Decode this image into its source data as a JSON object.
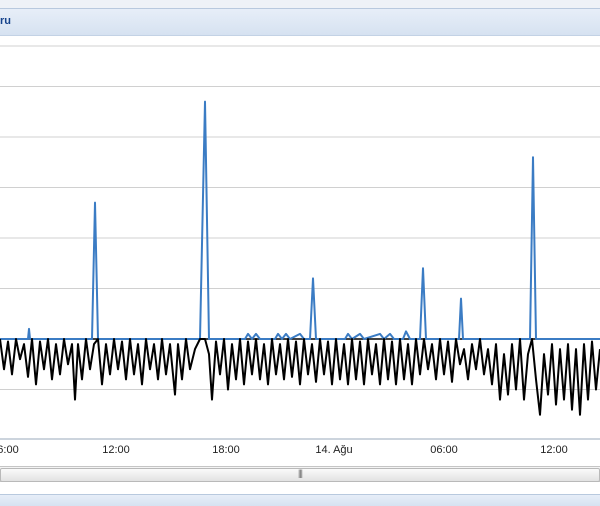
{
  "window": {
    "title_fragment": "ru"
  },
  "chart_data": {
    "type": "line",
    "x_tick_labels": [
      "6:00",
      "12:00",
      "18:00",
      "14. Ağu",
      "06:00",
      "12:00"
    ],
    "ylim": [
      -2,
      6
    ],
    "threshold_value": 0,
    "grid": true,
    "series": [
      {
        "color": "#3b7cc4",
        "points": [
          [
            0,
            0
          ],
          [
            28,
            0
          ],
          [
            29,
            0.2
          ],
          [
            30,
            0
          ],
          [
            92,
            0
          ],
          [
            95,
            2.7
          ],
          [
            98,
            0
          ],
          [
            200,
            0
          ],
          [
            205,
            4.7
          ],
          [
            209,
            0
          ],
          [
            245,
            0
          ],
          [
            248,
            0.1
          ],
          [
            252,
            0
          ],
          [
            256,
            0.1
          ],
          [
            260,
            0
          ],
          [
            275,
            0
          ],
          [
            278,
            0.1
          ],
          [
            282,
            0
          ],
          [
            286,
            0.1
          ],
          [
            290,
            0
          ],
          [
            300,
            0.1
          ],
          [
            304,
            0
          ],
          [
            310,
            0
          ],
          [
            313,
            1.2
          ],
          [
            316,
            0
          ],
          [
            345,
            0
          ],
          [
            348,
            0.1
          ],
          [
            352,
            0
          ],
          [
            360,
            0.1
          ],
          [
            364,
            0
          ],
          [
            380,
            0.1
          ],
          [
            384,
            0
          ],
          [
            390,
            0.1
          ],
          [
            394,
            0
          ],
          [
            403,
            0
          ],
          [
            406,
            0.15
          ],
          [
            410,
            0
          ],
          [
            420,
            0
          ],
          [
            423,
            1.4
          ],
          [
            426,
            0
          ],
          [
            459,
            0
          ],
          [
            461,
            0.8
          ],
          [
            463,
            0
          ],
          [
            530,
            0
          ],
          [
            533,
            3.6
          ],
          [
            536,
            0
          ],
          [
            600,
            0
          ]
        ]
      },
      {
        "color": "#000000",
        "points": [
          [
            0,
            0
          ],
          [
            4,
            -0.6
          ],
          [
            8,
            -0.05
          ],
          [
            12,
            -0.7
          ],
          [
            16,
            0
          ],
          [
            20,
            -0.4
          ],
          [
            24,
            -0.1
          ],
          [
            28,
            -0.75
          ],
          [
            32,
            0
          ],
          [
            36,
            -0.9
          ],
          [
            40,
            -0.05
          ],
          [
            44,
            -0.6
          ],
          [
            48,
            0
          ],
          [
            52,
            -0.8
          ],
          [
            56,
            -0.1
          ],
          [
            60,
            -0.7
          ],
          [
            64,
            0
          ],
          [
            68,
            -0.5
          ],
          [
            72,
            -0.1
          ],
          [
            75,
            -1.2
          ],
          [
            78,
            -0.1
          ],
          [
            82,
            -0.8
          ],
          [
            86,
            0
          ],
          [
            90,
            -0.6
          ],
          [
            94,
            -0.1
          ],
          [
            98,
            0
          ],
          [
            102,
            -0.9
          ],
          [
            106,
            -0.1
          ],
          [
            110,
            -0.7
          ],
          [
            114,
            0
          ],
          [
            118,
            -0.6
          ],
          [
            122,
            -0.05
          ],
          [
            126,
            -0.8
          ],
          [
            130,
            0
          ],
          [
            134,
            -0.7
          ],
          [
            138,
            -0.1
          ],
          [
            142,
            -0.9
          ],
          [
            146,
            0
          ],
          [
            150,
            -0.6
          ],
          [
            154,
            -0.1
          ],
          [
            158,
            -0.8
          ],
          [
            162,
            0
          ],
          [
            166,
            -0.7
          ],
          [
            170,
            -0.1
          ],
          [
            175,
            -1.1
          ],
          [
            178,
            -0.1
          ],
          [
            182,
            -0.8
          ],
          [
            186,
            0
          ],
          [
            190,
            -0.6
          ],
          [
            195,
            -0.2
          ],
          [
            200,
            0
          ],
          [
            205,
            0
          ],
          [
            209,
            -0.3
          ],
          [
            212,
            -1.2
          ],
          [
            216,
            -0.05
          ],
          [
            220,
            -0.7
          ],
          [
            224,
            0
          ],
          [
            228,
            -1.0
          ],
          [
            232,
            -0.1
          ],
          [
            236,
            -0.8
          ],
          [
            240,
            0
          ],
          [
            244,
            -0.9
          ],
          [
            248,
            -0.05
          ],
          [
            252,
            -0.7
          ],
          [
            256,
            0
          ],
          [
            260,
            -0.8
          ],
          [
            264,
            -0.1
          ],
          [
            268,
            -0.9
          ],
          [
            272,
            0
          ],
          [
            276,
            -0.7
          ],
          [
            280,
            -0.1
          ],
          [
            284,
            -0.8
          ],
          [
            288,
            0
          ],
          [
            292,
            -0.75
          ],
          [
            296,
            -0.05
          ],
          [
            300,
            -0.9
          ],
          [
            304,
            0
          ],
          [
            308,
            -0.7
          ],
          [
            312,
            -0.1
          ],
          [
            316,
            -0.85
          ],
          [
            320,
            0
          ],
          [
            324,
            -0.7
          ],
          [
            328,
            -0.05
          ],
          [
            332,
            -0.9
          ],
          [
            336,
            0
          ],
          [
            340,
            -0.8
          ],
          [
            344,
            -0.1
          ],
          [
            348,
            -0.9
          ],
          [
            352,
            0
          ],
          [
            356,
            -0.8
          ],
          [
            360,
            -0.05
          ],
          [
            364,
            -0.9
          ],
          [
            368,
            0
          ],
          [
            372,
            -0.7
          ],
          [
            376,
            -0.1
          ],
          [
            380,
            -0.9
          ],
          [
            384,
            0
          ],
          [
            388,
            -0.8
          ],
          [
            392,
            -0.05
          ],
          [
            396,
            -0.9
          ],
          [
            400,
            0
          ],
          [
            404,
            -0.8
          ],
          [
            408,
            -0.1
          ],
          [
            412,
            -0.9
          ],
          [
            416,
            0
          ],
          [
            420,
            -0.7
          ],
          [
            424,
            0
          ],
          [
            428,
            -0.6
          ],
          [
            432,
            -0.1
          ],
          [
            436,
            -0.8
          ],
          [
            440,
            0
          ],
          [
            444,
            -0.7
          ],
          [
            448,
            -0.05
          ],
          [
            452,
            -0.85
          ],
          [
            456,
            0
          ],
          [
            460,
            -0.5
          ],
          [
            464,
            -0.2
          ],
          [
            468,
            -0.8
          ],
          [
            472,
            -0.1
          ],
          [
            476,
            -0.6
          ],
          [
            480,
            0
          ],
          [
            484,
            -0.7
          ],
          [
            488,
            -0.2
          ],
          [
            492,
            -0.9
          ],
          [
            496,
            -0.1
          ],
          [
            500,
            -1.2
          ],
          [
            504,
            -0.3
          ],
          [
            508,
            -1.1
          ],
          [
            512,
            -0.1
          ],
          [
            516,
            -1.0
          ],
          [
            520,
            0
          ],
          [
            524,
            -1.2
          ],
          [
            528,
            -0.3
          ],
          [
            532,
            0
          ],
          [
            536,
            -0.8
          ],
          [
            540,
            -1.5
          ],
          [
            544,
            -0.3
          ],
          [
            548,
            -1.1
          ],
          [
            552,
            -0.1
          ],
          [
            556,
            -1.3
          ],
          [
            560,
            -0.2
          ],
          [
            564,
            -1.2
          ],
          [
            568,
            -0.1
          ],
          [
            572,
            -1.4
          ],
          [
            576,
            -0.2
          ],
          [
            580,
            -1.5
          ],
          [
            584,
            -0.1
          ],
          [
            588,
            -1.2
          ],
          [
            592,
            -0.05
          ],
          [
            596,
            -1.0
          ],
          [
            600,
            -0.2
          ]
        ]
      }
    ]
  },
  "scrollbar": {
    "grip_label": "|||"
  }
}
